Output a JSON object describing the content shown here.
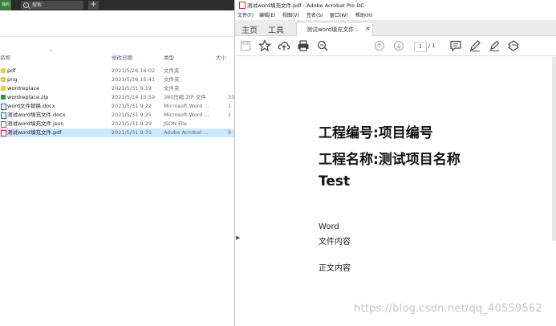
{
  "explorer": {
    "app_icon_text": "我的电脑",
    "search_placeholder": "搜索",
    "new_tab_glyph": "+",
    "columns": {
      "name": "名称",
      "date": "修改日期",
      "type": "类型",
      "size": "大小"
    },
    "files": [
      {
        "icon": "folder",
        "name": "pdf",
        "date": "2021/5/26 16:02",
        "type": "文件夹",
        "size": ""
      },
      {
        "icon": "folder",
        "name": "png",
        "date": "2021/5/26 15:41",
        "type": "文件夹",
        "size": ""
      },
      {
        "icon": "folder",
        "name": "wordreplace",
        "date": "2021/5/31 9:19",
        "type": "文件夹",
        "size": ""
      },
      {
        "icon": "zip",
        "name": "wordreplace.zip",
        "date": "2021/5/14 15:59",
        "type": "360压缩 ZIP 文件",
        "size": "33"
      },
      {
        "icon": "docx",
        "name": "word文件替换.docx",
        "date": "2021/5/31 9:22",
        "type": "Microsoft Word ...",
        "size": "1"
      },
      {
        "icon": "docx",
        "name": "测试word填充文件.docx",
        "date": "2021/5/31 9:25",
        "type": "Microsoft Word ...",
        "size": "1"
      },
      {
        "icon": "json",
        "name": "测试word填充文件.json",
        "date": "2021/5/31 9:29",
        "type": "JSON File",
        "size": ""
      },
      {
        "icon": "pdf",
        "name": "测试word填充文件.pdf",
        "date": "2021/5/31 9:31",
        "type": "Adobe Acrobat ...",
        "size": "8"
      }
    ]
  },
  "acrobat": {
    "window_title": "测试word填充文件.pdf - Adobe Acrobat Pro DC",
    "menu": [
      "文件(F)",
      "编辑(E)",
      "视图(V)",
      "签名(S)",
      "窗口(W)",
      "帮助(H)"
    ],
    "nav_home": "主页",
    "nav_tools": "工具",
    "doc_tab_label": "测试word填充文件...",
    "doc_tab_close": "×",
    "page_current": "1",
    "page_total": "/ 1",
    "toolbar_icons": [
      "save-icon",
      "bookmark-star-icon",
      "upload-cloud-icon",
      "print-icon",
      "zoom-icon",
      "page-up-icon",
      "page-down-icon",
      "comment-icon",
      "pen-icon",
      "sign-icon",
      "stamp-icon"
    ],
    "document": {
      "line1": "工程编号:项目编号",
      "line2": "工程名称:测试项目名称",
      "line3": "Test",
      "line4": "Word",
      "line5": "文件内容",
      "line6": "正文内容"
    },
    "watermark": "https://blog.csdn.net/qq_40559562"
  },
  "colors": {
    "selected_row": "#cce8ff",
    "folder": "#f3c74f",
    "pdf_red": "#dd2222",
    "word_blue": "#2b579a"
  }
}
